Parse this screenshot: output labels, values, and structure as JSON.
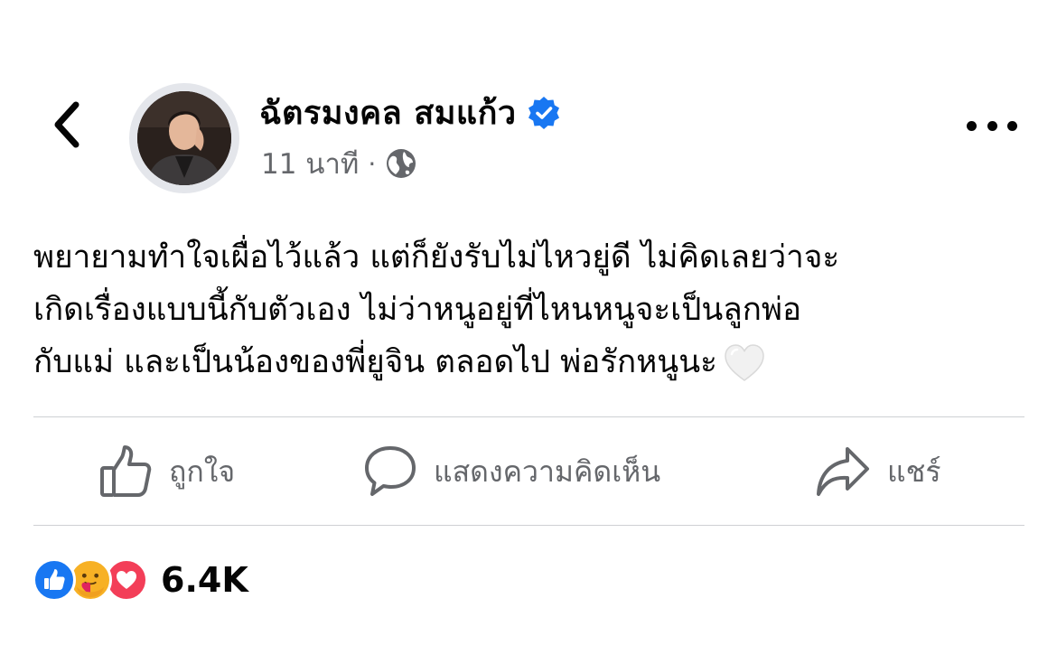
{
  "post": {
    "author_name": "ฉัตรมงคล สมแก้ว",
    "time": "11 นาที",
    "separator": "·",
    "text": "พยายามทำใจเผื่อไว้แล้ว แต่ก็ยังรับไม่ไหวยู่ดี ไม่คิดเลยว่าจะ\nเกิดเรื่องแบบนี้กับตัวเอง ไม่ว่าหนูอยู่ที่ไหนหนูจะเป็นลูกพ่อ\nกับแม่ และเป็นน้องของพี่ยูจิน ตลอดไป พ่อรักหนูนะ"
  },
  "actions": {
    "like_label": "ถูกใจ",
    "comment_label": "แสดงความคิดเห็น",
    "share_label": "แชร์"
  },
  "reactions": {
    "count": "6.4K",
    "types": [
      "like",
      "care",
      "love"
    ]
  },
  "colors": {
    "verified": "#1877f2",
    "like": "#1877f2",
    "love": "#f33e58",
    "care": "#f7b125",
    "secondary_text": "#65676b"
  },
  "icons": [
    "back-chevron-icon",
    "verified-badge-icon",
    "globe-icon",
    "more-dots-icon",
    "white-heart-icon",
    "thumbs-up-icon",
    "comment-bubble-icon",
    "share-arrow-icon"
  ]
}
